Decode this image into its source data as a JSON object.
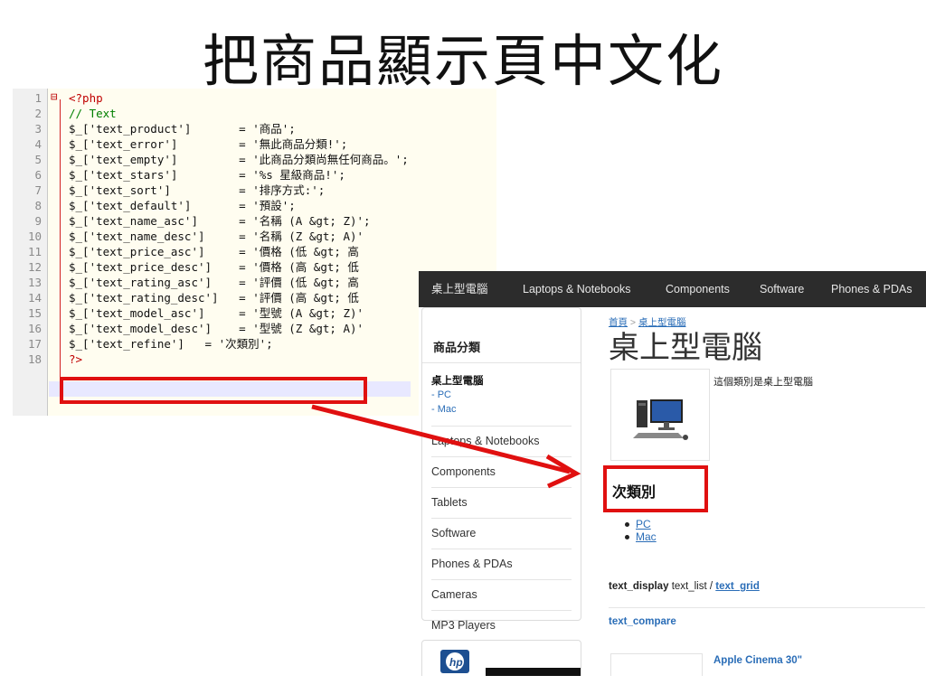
{
  "slide": {
    "title": "把商品顯示頁中文化"
  },
  "editor": {
    "lines": [
      {
        "num": "1",
        "text": "<?php"
      },
      {
        "num": "2",
        "text": "// Text"
      },
      {
        "num": "3",
        "text": "$_['text_product']       = '商品';"
      },
      {
        "num": "4",
        "text": "$_['text_error']         = '無此商品分類!';"
      },
      {
        "num": "5",
        "text": "$_['text_empty']         = '此商品分類尚無任何商品。';"
      },
      {
        "num": "6",
        "text": "$_['text_stars']         = '%s 星級商品!';"
      },
      {
        "num": "7",
        "text": "$_['text_sort']          = '排序方式:';"
      },
      {
        "num": "8",
        "text": "$_['text_default']       = '預設';"
      },
      {
        "num": "9",
        "text": "$_['text_name_asc']      = '名稱 (A &gt; Z)';"
      },
      {
        "num": "10",
        "text": "$_['text_name_desc']     = '名稱 (Z &gt; A)'"
      },
      {
        "num": "11",
        "text": "$_['text_price_asc']     = '價格 (低 &gt; 高"
      },
      {
        "num": "12",
        "text": "$_['text_price_desc']    = '價格 (高 &gt; 低"
      },
      {
        "num": "13",
        "text": "$_['text_rating_asc']    = '評價 (低 &gt; 高"
      },
      {
        "num": "14",
        "text": "$_['text_rating_desc']   = '評價 (高 &gt; 低"
      },
      {
        "num": "15",
        "text": "$_['text_model_asc']     = '型號 (A &gt; Z)'"
      },
      {
        "num": "16",
        "text": "$_['text_model_desc']    = '型號 (Z &gt; A)'"
      },
      {
        "num": "17",
        "text": "$_['text_refine']   = '次類別';"
      },
      {
        "num": "18",
        "text": "?>"
      }
    ]
  },
  "site": {
    "nav": [
      "桌上型電腦",
      "Laptops & Notebooks",
      "Components",
      "Software",
      "Phones & PDAs"
    ],
    "sidebar": {
      "heading": "商品分類",
      "active": "桌上型電腦",
      "subs": [
        "- PC",
        "- Mac"
      ],
      "items": [
        "Laptops & Notebooks",
        "Components",
        "Tablets",
        "Software",
        "Phones & PDAs",
        "Cameras",
        "MP3 Players"
      ]
    },
    "breadcrumb": {
      "home": "首頁",
      "sep": " > ",
      "current": "桌上型電腦"
    },
    "page_heading": "桌上型電腦",
    "category_description": "這個類別是桌上型電腦",
    "refine_heading": "次類別",
    "refine_items": [
      "PC",
      "Mac"
    ],
    "display": {
      "label": "text_display",
      "list": "text_list",
      "sep": " / ",
      "grid": "text_grid"
    },
    "compare": "text_compare",
    "product_name": "Apple Cinema 30\""
  }
}
